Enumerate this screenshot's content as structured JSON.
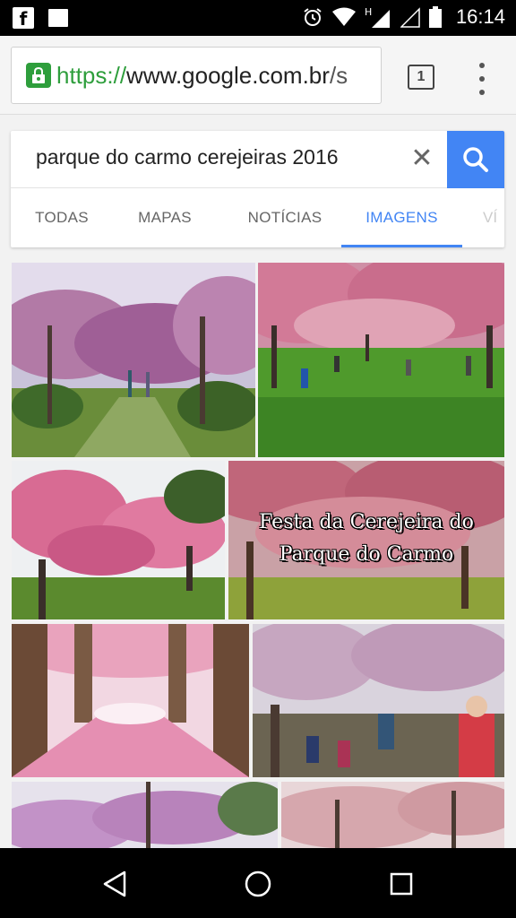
{
  "status_bar": {
    "time": "16:14",
    "icons": [
      "facebook-icon",
      "image-icon",
      "alarm-icon",
      "wifi-icon",
      "signal-h-icon",
      "signal-icon",
      "battery-icon"
    ]
  },
  "browser": {
    "url_scheme": "https://",
    "url_host": "www.google.com.br",
    "url_rest": "/s",
    "tab_count": "1"
  },
  "search": {
    "query": "parque do carmo cerejeiras 2016",
    "clear_label": "✕"
  },
  "tabs": [
    {
      "label": "TODAS"
    },
    {
      "label": "MAPAS"
    },
    {
      "label": "NOTÍCIAS"
    },
    {
      "label": "IMAGENS"
    },
    {
      "label": "VÍ"
    }
  ],
  "active_tab": "IMAGENS",
  "results": {
    "overlay_caption_line1": "Festa da Cerejeira do",
    "overlay_caption_line2": "Parque do Carmo"
  },
  "colors": {
    "accent": "#4285f4",
    "secure": "#2e9e3c"
  }
}
